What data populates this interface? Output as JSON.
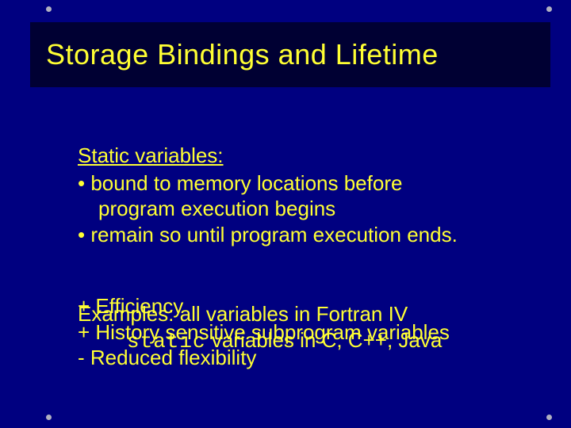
{
  "slide": {
    "title": "Storage Bindings and Lifetime",
    "heading": "Static variables:",
    "bullets": [
      "•  bound to memory locations before",
      "program execution begins",
      "•  remain so until program execution ends."
    ],
    "overlap": {
      "layerA": {
        "line1": " + Efficiency",
        "line2": " + History sensitive subprogram variables",
        "line3": " -  Reduced flexibility"
      },
      "layerB": {
        "line1": "Examples:  all variables in Fortran IV",
        "line2_pre": "static",
        "line2_post": " variables in C, C++, Java"
      }
    }
  }
}
